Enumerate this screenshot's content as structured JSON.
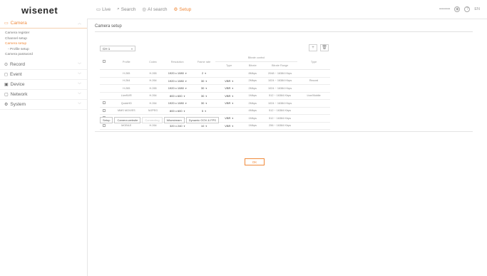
{
  "header": {
    "logo": "wisenet",
    "nav": [
      {
        "label": "Live",
        "icon": "monitor-icon"
      },
      {
        "label": "Search",
        "icon": "search-icon"
      },
      {
        "label": "AI search",
        "icon": "ai-search-icon"
      },
      {
        "label": "Setup",
        "icon": "gear-icon"
      }
    ],
    "active_nav": "Setup",
    "user": "••••••••",
    "lang": "EN"
  },
  "sidebar": {
    "menus": [
      {
        "label": "Camera",
        "icon": "camera-icon",
        "active": true,
        "items": [
          "Camera register",
          "Channel setup",
          "Camera setup",
          "Profile setup",
          "Camera password"
        ]
      },
      {
        "label": "Record",
        "icon": "record-icon",
        "active": false,
        "items": []
      },
      {
        "label": "Event",
        "icon": "event-icon",
        "active": false,
        "items": []
      },
      {
        "label": "Device",
        "icon": "device-icon",
        "active": false,
        "items": []
      },
      {
        "label": "Network",
        "icon": "network-icon",
        "active": false,
        "items": []
      },
      {
        "label": "System",
        "icon": "system-icon",
        "active": false,
        "items": []
      }
    ]
  },
  "main": {
    "title": "Camera setup",
    "channel": "CH 1",
    "table": {
      "group_header": "Bitrate control",
      "columns": [
        "Profile",
        "Codec",
        "Resolution",
        "Frame rate",
        "Type",
        "Bitrate",
        "Bitrate Range",
        "Type"
      ],
      "rows": [
        {
          "profile": "H.265",
          "codec": "H.265",
          "res": "1920 x 1080",
          "fps": "2",
          "type": "",
          "bitrate": "8Mbps",
          "range": "2048 ~ 16384 Kbps",
          "type2": "",
          "checkbox": false
        },
        {
          "profile": "H.264",
          "codec": "H.264",
          "res": "1920 x 1080",
          "fps": "30",
          "type": "VBR",
          "bitrate": "2Mbps",
          "range": "1024 ~ 16384 Kbps",
          "type2": "Record",
          "checkbox": false
        },
        {
          "profile": "H.265",
          "codec": "H.265",
          "res": "1920 x 1080",
          "fps": "30",
          "type": "VBR",
          "bitrate": "2Mbps",
          "range": "1024 ~ 16384 Kbps",
          "type2": "",
          "checkbox": false
        },
        {
          "profile": "LiveNVR",
          "codec": "H.264",
          "res": "800 x 600",
          "fps": "30",
          "type": "VBR",
          "bitrate": "1Mbps",
          "range": "512 ~ 16384 Kbps",
          "type2": "Live/Mobile",
          "checkbox": false
        },
        {
          "profile": "QuickHD",
          "codec": "H.264",
          "res": "1920 x 1080",
          "fps": "30",
          "type": "VBR",
          "bitrate": "2Mbps",
          "range": "1024 ~ 16384 Kbps",
          "type2": "",
          "checkbox": true
        },
        {
          "profile": "MMS MOVIES",
          "codec": "MJPEG",
          "res": "800 x 600",
          "fps": "5",
          "type": "",
          "bitrate": "4Mbps",
          "range": "512 ~ 16384 Kbps",
          "type2": "",
          "checkbox": true
        },
        {
          "profile": "LiveNVR",
          "codec": "H.264",
          "res": "640 x 360",
          "fps": "15",
          "type": "VBR",
          "bitrate": "1Mbps",
          "range": "512 ~ 16384 Kbps",
          "type2": "",
          "checkbox": true
        },
        {
          "profile": "MOBILE",
          "codec": "H.264",
          "res": "320 x 240",
          "fps": "10",
          "type": "VBR",
          "bitrate": "1Mbps",
          "range": "256 ~ 16384 Kbps",
          "type2": "",
          "checkbox": true
        }
      ]
    },
    "buttons": [
      "Setup",
      "Camera website",
      "Connecting",
      "Wisestream",
      "Dynamic GOV & FPS"
    ],
    "disabled_button": "Connecting",
    "ok": "OK"
  },
  "colors": {
    "accent": "#f08a3c"
  }
}
